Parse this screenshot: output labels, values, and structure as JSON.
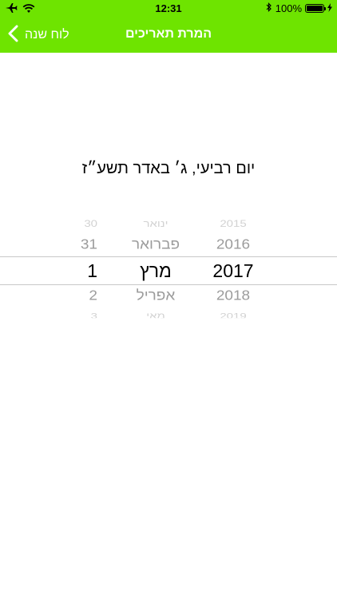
{
  "status_bar": {
    "time": "12:31",
    "battery": "100%",
    "battery_level_percent": 100
  },
  "nav": {
    "title": "המרת תאריכים",
    "back_label": "לוח שנה"
  },
  "hebrew_date": "יום רביעי, ג׳ באדר תשע״ז",
  "picker": {
    "days": [
      "30",
      "31",
      "1",
      "2",
      "3"
    ],
    "months": [
      "ינואר",
      "פברואר",
      "מרץ",
      "אפריל",
      "מאי"
    ],
    "years": [
      "2015",
      "2016",
      "2017",
      "2018",
      "2019"
    ]
  },
  "colors": {
    "header": "#6ee400",
    "header_text": "#ffffff",
    "picker_selected": "#000000",
    "picker_unselected": "#9c9c9c"
  }
}
